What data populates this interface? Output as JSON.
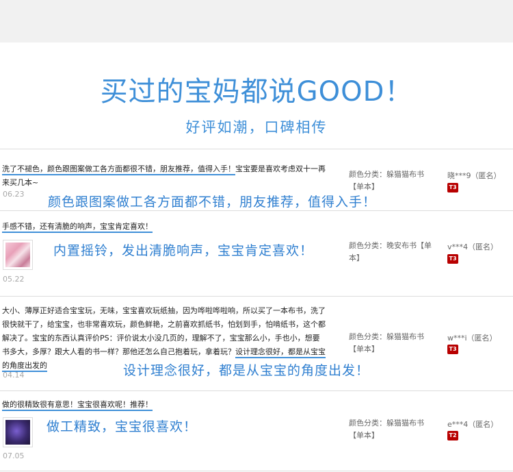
{
  "hero": {
    "title": "买过的宝妈都说GOOD！",
    "subtitle": "好评如潮，口碑相传"
  },
  "reviews": [
    {
      "text_pre": "",
      "text_ul": "洗了不褪色，颜色跟图案做工各方面都很不错，朋友推荐，值得入手！",
      "text_post": "宝宝要是喜欢考虑双十一再来买几本~",
      "date": "06.23",
      "highlight": "颜色跟图案做工各方面都不错，朋友推荐，值得入手！",
      "variant": "颜色分类：躲猫猫布书【单本】",
      "user": "晓***9（匿名）",
      "badge": "T3"
    },
    {
      "text_pre": "",
      "text_ul": "手感不错，还有清脆的响声，宝宝肯定喜欢！",
      "text_post": "",
      "date": "05.22",
      "highlight": "内置摇铃，发出清脆响声，宝宝肯定喜欢！",
      "variant": "颜色分类：晚安布书【单本】",
      "user": "v***4（匿名）",
      "badge": "T3"
    },
    {
      "text_pre": "大小、薄厚正好适合宝宝玩，无味，宝宝喜欢玩纸抽，因为哗啦哗啦响，所以买了一本布书，洗了很快就干了，给宝宝，也非常喜欢玩，颜色鲜艳，之前喜欢抓纸书，怕划到手，怕啃纸书，这个都解决了。宝宝的东西认真评价PS：评价说太小没几页的，理解不了，宝宝那么小，手也小，想要书多大，多厚？跟大人看的书一样？那他还怎么自己抱着玩，拿着玩？",
      "text_ul": "设计理念很好，都是从宝宝的角度出发的",
      "text_post": "",
      "date": "04.14",
      "highlight": "设计理念很好，都是从宝宝的角度出发！",
      "variant": "颜色分类：躲猫猫布书【单本】",
      "user": "w***i（匿名）",
      "badge": "T3"
    },
    {
      "text_pre": "",
      "text_ul": "做的很精致很有意思！宝宝很喜欢呢！推荐！",
      "text_post": "",
      "date": "07.05",
      "highlight": "做工精致，宝宝很喜欢！",
      "variant": "颜色分类：躲猫猫布书【单本】",
      "user": "e***4（匿名）",
      "badge": "T2"
    }
  ],
  "colors": {
    "accent": "#3e8fd8",
    "badge": "#b80000"
  }
}
